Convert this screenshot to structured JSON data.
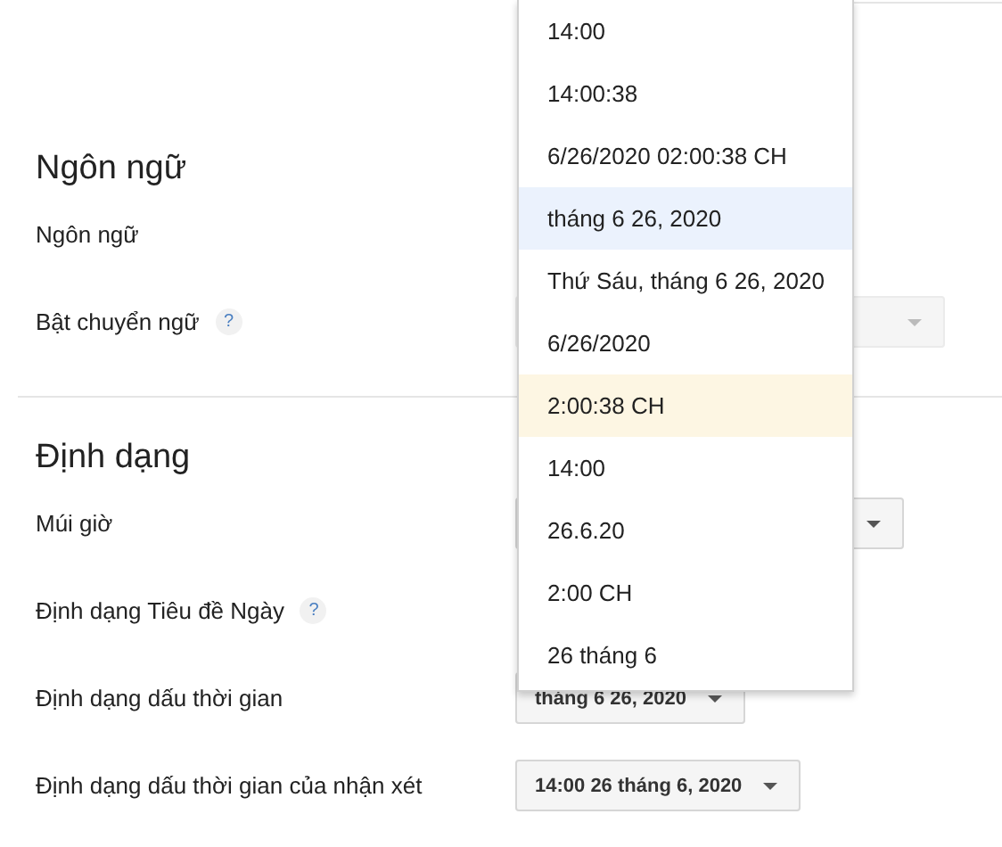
{
  "sections": [
    {
      "title": "Ngôn ngữ",
      "rows": [
        {
          "label": "Ngôn ngữ"
        },
        {
          "label": "Bật chuyển ngữ",
          "help": "?",
          "control": {
            "kind": "dropdown",
            "disabled": true
          }
        }
      ]
    },
    {
      "title": "Định dạng",
      "rows": [
        {
          "label": "Múi giờ",
          "control": {
            "kind": "dropdown",
            "disabled": false
          }
        },
        {
          "label": "Định dạng Tiêu đề Ngày",
          "help": "?"
        },
        {
          "label": "Định dạng dấu thời gian",
          "control": {
            "kind": "dropdown",
            "disabled": false,
            "value": "tháng 6 26, 2020"
          }
        },
        {
          "label": "Định dạng dấu thời gian của nhận xét",
          "control": {
            "kind": "dropdown",
            "disabled": false,
            "value": "14:00 26 tháng 6, 2020"
          }
        }
      ]
    }
  ],
  "menu": {
    "items": [
      {
        "label": "14:00",
        "selected": false,
        "hovered": false
      },
      {
        "label": "14:00:38",
        "selected": false,
        "hovered": false
      },
      {
        "label": "6/26/2020 02:00:38 CH",
        "selected": false,
        "hovered": false
      },
      {
        "label": "tháng 6 26, 2020",
        "selected": true,
        "hovered": false
      },
      {
        "label": "Thứ Sáu, tháng 6 26, 2020",
        "selected": false,
        "hovered": false
      },
      {
        "label": "6/26/2020",
        "selected": false,
        "hovered": false
      },
      {
        "label": "2:00:38 CH",
        "selected": false,
        "hovered": true
      },
      {
        "label": "14:00",
        "selected": false,
        "hovered": false
      },
      {
        "label": "26.6.20",
        "selected": false,
        "hovered": false
      },
      {
        "label": "2:00 CH",
        "selected": false,
        "hovered": false
      },
      {
        "label": "26 tháng 6",
        "selected": false,
        "hovered": false
      }
    ]
  }
}
